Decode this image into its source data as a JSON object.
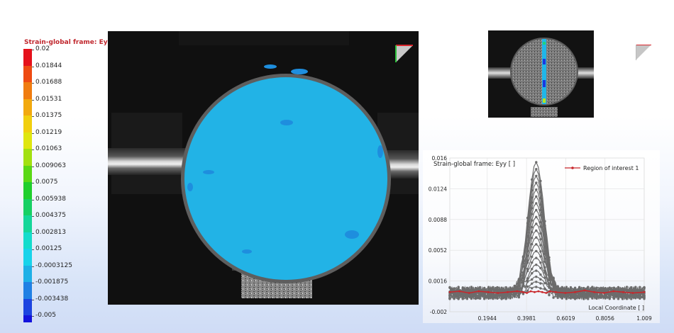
{
  "legend": {
    "title": "Strain-global frame: Eyy [ ]",
    "entries": [
      {
        "label": "0.02",
        "color": "#e5111b"
      },
      {
        "label": "0.01844",
        "color": "#ee4a12"
      },
      {
        "label": "0.01688",
        "color": "#f07c10"
      },
      {
        "label": "0.01531",
        "color": "#f2a90f"
      },
      {
        "label": "0.01375",
        "color": "#f1cf0e"
      },
      {
        "label": "0.01219",
        "color": "#dfe60f"
      },
      {
        "label": "0.01063",
        "color": "#a2e010"
      },
      {
        "label": "0.009063",
        "color": "#5ad815"
      },
      {
        "label": "0.0075",
        "color": "#1fcf2c"
      },
      {
        "label": "0.005938",
        "color": "#17d063"
      },
      {
        "label": "0.004375",
        "color": "#14d699"
      },
      {
        "label": "0.002813",
        "color": "#13dccc"
      },
      {
        "label": "0.00125",
        "color": "#18d3ea"
      },
      {
        "label": "-0.0003125",
        "color": "#1eb0e6"
      },
      {
        "label": "-0.001875",
        "color": "#2080e4"
      },
      {
        "label": "-0.003438",
        "color": "#1c44e0"
      },
      {
        "label": "-0.005",
        "color": "#1313dc"
      }
    ]
  },
  "colors": {
    "strain_field": "#22b3e6",
    "series": "#c8262b",
    "points": "#6c6c6c"
  },
  "chart_data": {
    "type": "line",
    "title": "Strain-global frame: Eyy [ ]",
    "xlabel": "Local Coordinate [ ]",
    "ylabel": "",
    "x_ticks": [
      "0.1944",
      "0.3981",
      "0.6019",
      "0.8056",
      "1.009"
    ],
    "y_ticks": [
      "0.016",
      "0.0124",
      "0.0088",
      "0.0052",
      "0.0016",
      "-0.002"
    ],
    "xlim": [
      0,
      1.009
    ],
    "ylim": [
      -0.002,
      0.016
    ],
    "legend": {
      "label": "Region of interest 1",
      "position": "top-right"
    },
    "x": [
      0,
      0.05,
      0.1,
      0.15,
      0.2,
      0.25,
      0.3,
      0.35,
      0.38,
      0.4,
      0.42,
      0.44,
      0.46,
      0.48,
      0.5,
      0.52,
      0.55,
      0.6,
      0.65,
      0.7,
      0.75,
      0.8,
      0.85,
      0.9,
      0.95,
      1.009
    ],
    "series": [
      {
        "name": "Region of interest 1",
        "values": [
          0.0003,
          0.0004,
          0.0002,
          0.0004,
          0.0003,
          0.0002,
          0.0003,
          0.0004,
          0.0003,
          0.0002,
          0.0004,
          0.0003,
          0.0004,
          0.0003,
          0.0002,
          0.0004,
          0.0003,
          0.0002,
          0.0003,
          0.0005,
          0.0003,
          0.0002,
          0.0004,
          0.0003,
          0.0002,
          0.0003
        ]
      }
    ],
    "peak_curve": {
      "center": 0.448,
      "width": 0.042,
      "peaks": [
        0.0155,
        0.0147,
        0.0139,
        0.0131,
        0.0123,
        0.0115,
        0.0107,
        0.0099,
        0.0091,
        0.0083,
        0.0075,
        0.0067,
        0.0059,
        0.0051,
        0.0043,
        0.0035,
        0.0028,
        0.0021,
        0.0015,
        0.0009
      ]
    }
  }
}
